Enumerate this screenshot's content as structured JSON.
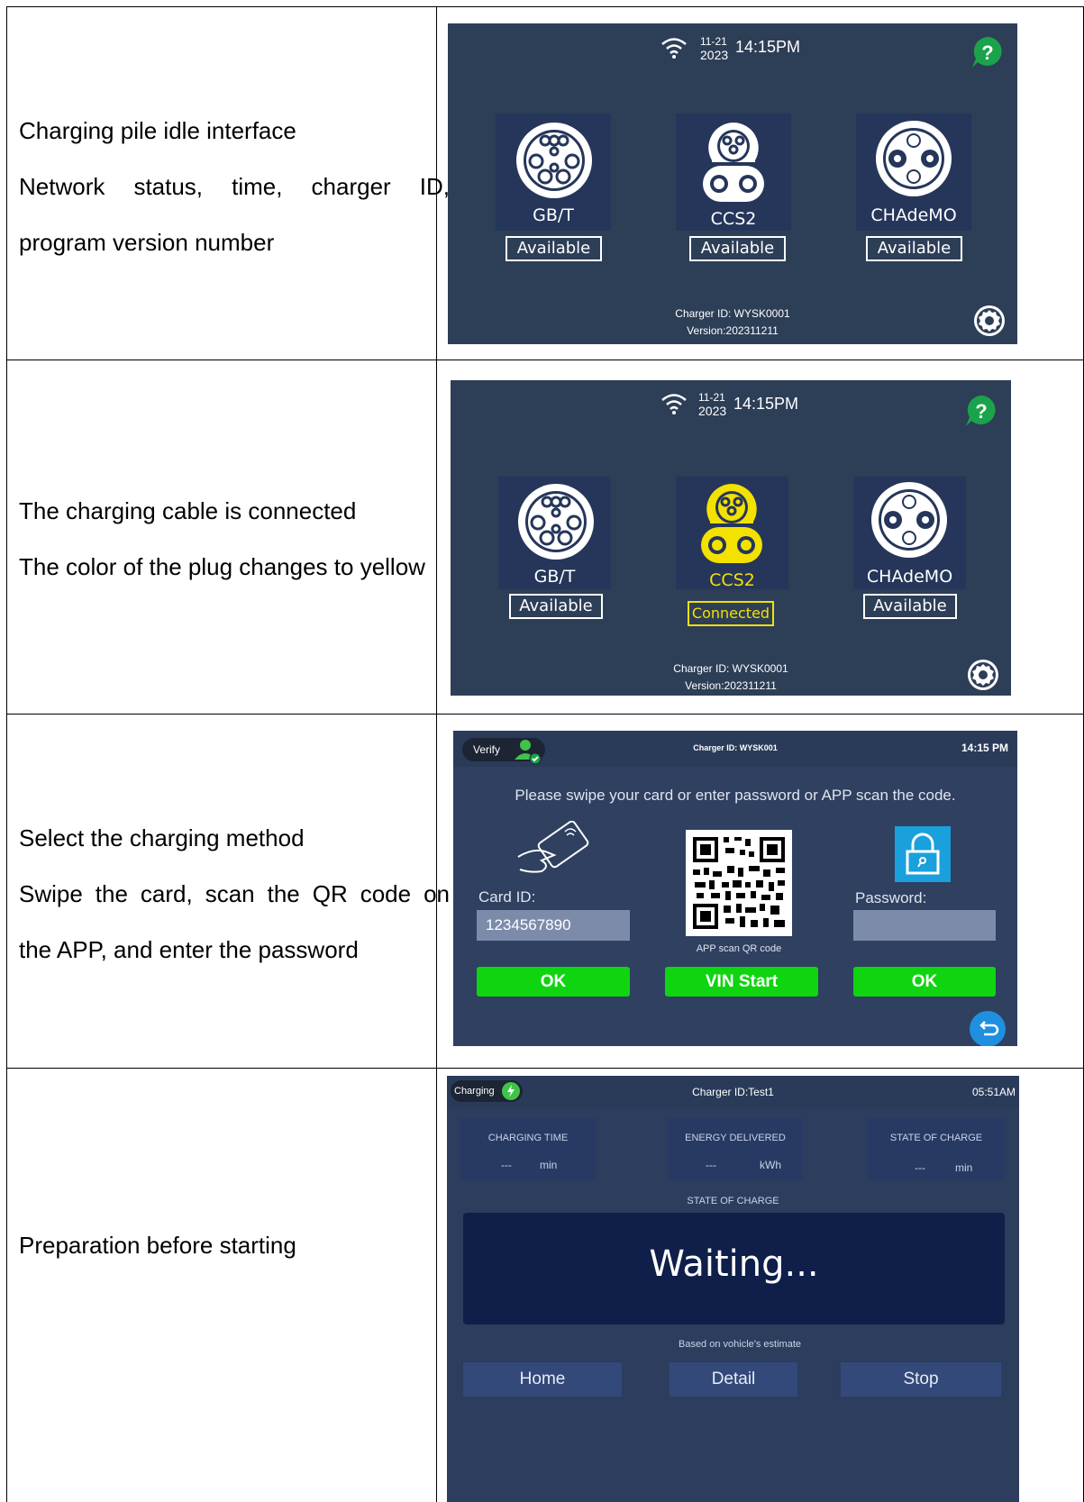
{
  "rows": [
    {
      "lines": [
        "Charging pile idle interface",
        "Network status, time, charger ID,",
        "program version number"
      ],
      "screen": {
        "date_top": "11-21",
        "date_year": "2023",
        "time": "14:15PM",
        "connectors": [
          {
            "name": "GB/T",
            "status": "Available"
          },
          {
            "name": "CCS2",
            "status": "Available"
          },
          {
            "name": "CHAdeMO",
            "status": "Available"
          }
        ],
        "charger_id": "Charger ID: WYSK0001",
        "version": "Version:202311211"
      }
    },
    {
      "lines": [
        "The charging cable is connected",
        "The color of the plug changes to yellow"
      ],
      "screen": {
        "date_top": "11-21",
        "date_year": "2023",
        "time": "14:15PM",
        "connectors": [
          {
            "name": "GB/T",
            "status": "Available"
          },
          {
            "name": "CCS2",
            "status": "Connected"
          },
          {
            "name": "CHAdeMO",
            "status": "Available"
          }
        ],
        "charger_id": "Charger ID: WYSK0001",
        "version": "Version:202311211"
      }
    },
    {
      "lines": [
        "Select the charging method",
        "Swipe the card, scan the QR code on",
        "the APP, and enter the password"
      ],
      "screen": {
        "verify_label": "Verify",
        "charger_id": "Charger ID:   WYSK001",
        "time": "14:15 PM",
        "prompt": "Please swipe your card or enter password or APP scan the code.",
        "card_id_label": "Card ID:",
        "card_id_value": "1234567890",
        "qr_caption": "APP scan QR code",
        "password_label": "Password:",
        "ok_left": "OK",
        "vin_start": "VIN Start",
        "ok_right": "OK"
      }
    },
    {
      "lines": [
        "Preparation before starting"
      ],
      "screen": {
        "charging_label": "Charging",
        "charger_id": "Charger ID:Test1",
        "time": "05:51AM",
        "cards": [
          {
            "title": "CHARGING TIME",
            "value": "---",
            "unit": "min"
          },
          {
            "title": "ENERGY DELIVERED",
            "value": "---",
            "unit": "kWh"
          },
          {
            "title": "STATE OF CHARGE",
            "value": "---",
            "unit": "min"
          }
        ],
        "soc_label": "STATE OF CHARGE",
        "status": "Waiting...",
        "note": "Based on vohicle's estimate",
        "home": "Home",
        "detail": "Detail",
        "stop": "Stop"
      }
    }
  ],
  "colors": {
    "screen_bg": "#2d3e57",
    "yellow": "#f3e100",
    "green": "#0fd410",
    "help": "#1aa34a"
  }
}
